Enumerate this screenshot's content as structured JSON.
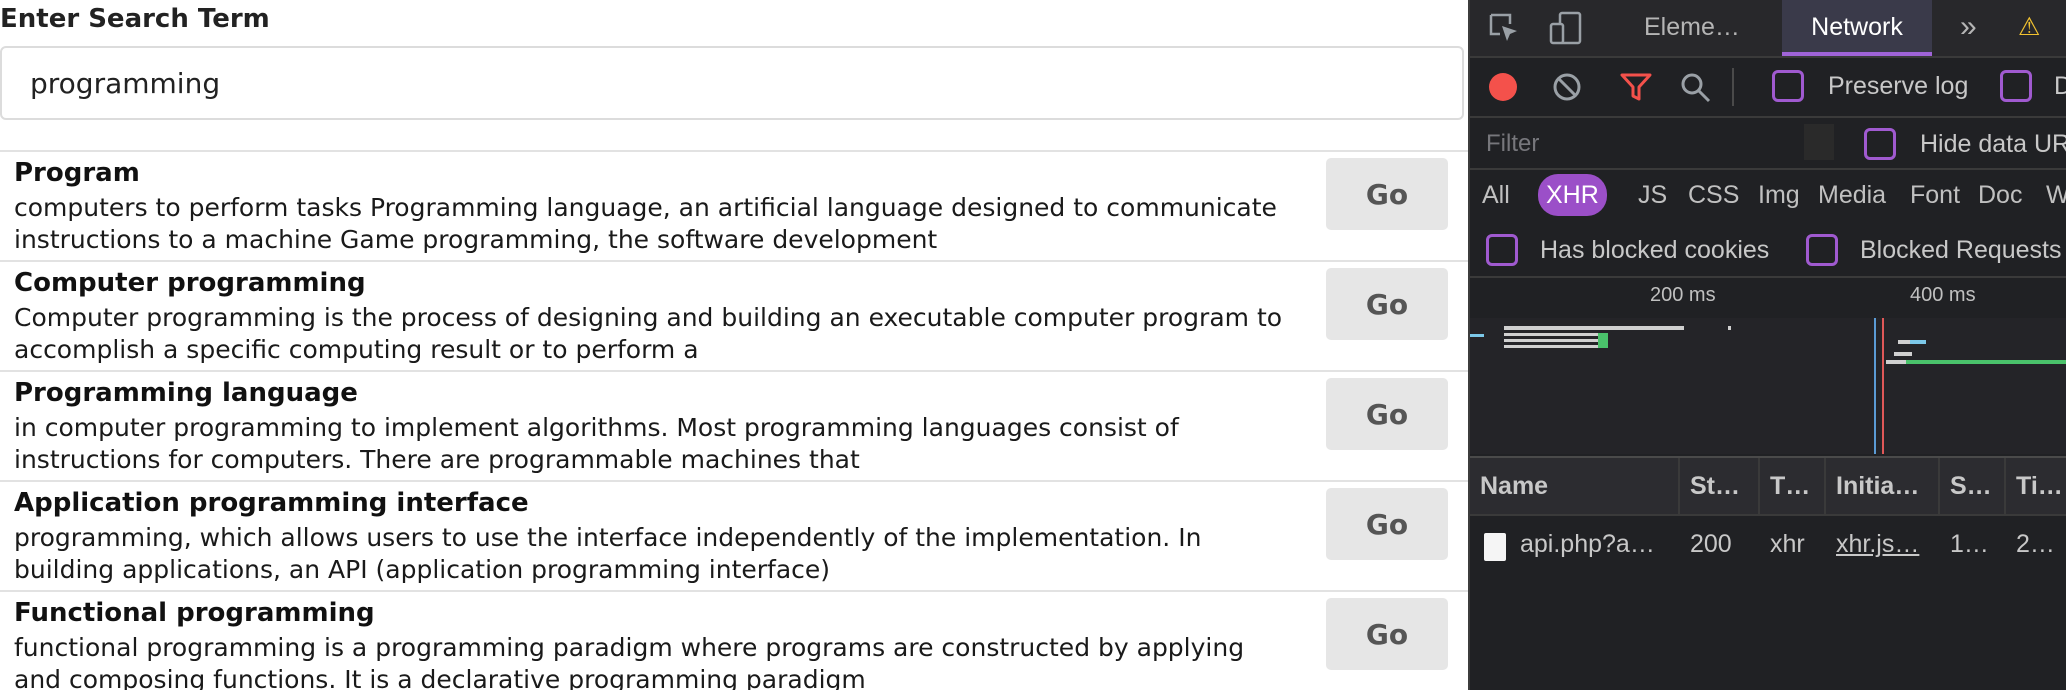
{
  "search": {
    "label": "Enter Search Term",
    "value": "programming"
  },
  "results": [
    {
      "title": "Program",
      "description": "computers to perform tasks Programming language, an artificial language designed to communicate instructions to a machine Game programming, the software development",
      "button_label": "Go"
    },
    {
      "title": "Computer programming",
      "description": "Computer programming is the process of designing and building an executable computer program to accomplish a specific computing result or to perform a",
      "button_label": "Go"
    },
    {
      "title": "Programming language",
      "description": "in computer programming to implement algorithms. Most programming languages consist of instructions for computers. There are programmable machines that",
      "button_label": "Go"
    },
    {
      "title": "Application programming interface",
      "description": "programming, which allows users to use the interface independently of the implementation. In building applications, an API (application programming interface)",
      "button_label": "Go"
    },
    {
      "title": "Functional programming",
      "description": "functional programming is a programming paradigm where programs are constructed by applying and composing functions. It is a declarative programming paradigm",
      "button_label": "Go"
    }
  ],
  "devtools": {
    "tabs": [
      {
        "label": "Eleme…",
        "active": false
      },
      {
        "label": "Network",
        "active": true
      }
    ],
    "more_tabs_glyph": "»",
    "warning_glyph": "⚠",
    "toolbar": {
      "preserve_log_label": "Preserve log",
      "disable_cache_label": "D"
    },
    "filter": {
      "placeholder": "Filter",
      "hide_data_urls_label": "Hide data UR"
    },
    "types": [
      "All",
      "XHR",
      "JS",
      "CSS",
      "Img",
      "Media",
      "Font",
      "Doc",
      "W"
    ],
    "active_type": "XHR",
    "has_blocked_cookies_label": "Has blocked cookies",
    "blocked_requests_label": "Blocked Requests",
    "timeline_ticks": [
      "200 ms",
      "400 ms"
    ],
    "table": {
      "headers": [
        "Name",
        "St…",
        "T…",
        "Initia…",
        "S…",
        "Ti…"
      ],
      "rows": [
        {
          "name": "api.php?a…",
          "status": "200",
          "type": "xhr",
          "initiator": "xhr.js…",
          "size": "1…",
          "time": "2…"
        }
      ]
    },
    "colors": {
      "record": "#f4514b",
      "accent": "#9b4fc8",
      "filter_icon": "#f4514b"
    }
  }
}
